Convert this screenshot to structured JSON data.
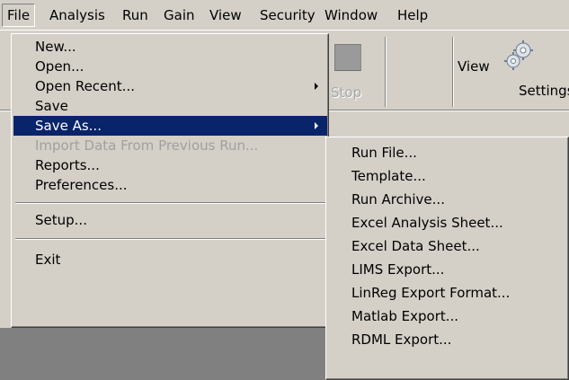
{
  "menubar": {
    "items": [
      {
        "label": "File"
      },
      {
        "label": "Analysis"
      },
      {
        "label": "Run"
      },
      {
        "label": "Gain"
      },
      {
        "label": "View"
      },
      {
        "label": "Security"
      },
      {
        "label": "Window"
      },
      {
        "label": "Help"
      }
    ]
  },
  "toolbar": {
    "stop_label": "Stop",
    "view_label": "View",
    "settings_label": "Settings"
  },
  "file_menu": {
    "items": [
      {
        "label": "New..."
      },
      {
        "label": "Open..."
      },
      {
        "label": "Open Recent..."
      },
      {
        "label": "Save"
      },
      {
        "label": "Save As..."
      },
      {
        "label": "Import Data From Previous Run..."
      },
      {
        "label": "Reports..."
      },
      {
        "label": "Preferences..."
      },
      {
        "label": "Setup..."
      },
      {
        "label": "Exit"
      }
    ]
  },
  "save_as_submenu": {
    "items": [
      {
        "label": "Run File..."
      },
      {
        "label": "Template..."
      },
      {
        "label": "Run Archive..."
      },
      {
        "label": "Excel Analysis Sheet..."
      },
      {
        "label": "Excel Data Sheet..."
      },
      {
        "label": "LIMS Export..."
      },
      {
        "label": "LinReg Export Format..."
      },
      {
        "label": "Matlab Export..."
      },
      {
        "label": "RDML Export..."
      }
    ]
  },
  "colors": {
    "menu_highlight": "#0a246a",
    "window_face": "#d4d0c8",
    "disabled_text": "#a0a0a0"
  }
}
